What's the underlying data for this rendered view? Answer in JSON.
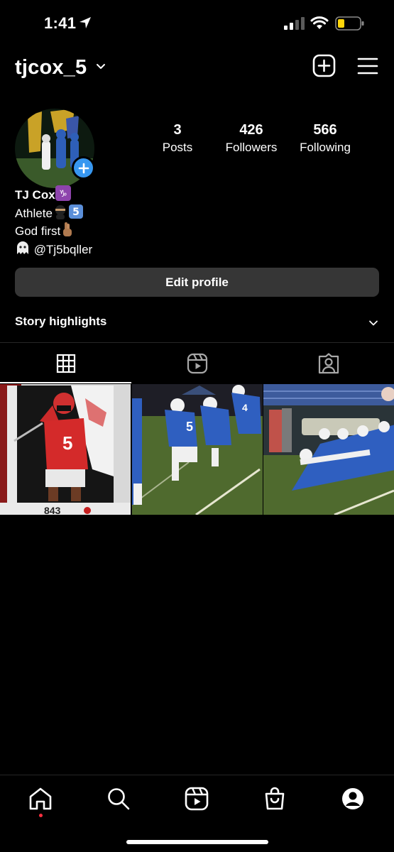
{
  "status_bar": {
    "time": "1:41",
    "icons": [
      "location-arrow-icon",
      "cellular-signal-icon",
      "wifi-icon",
      "battery-icon"
    ],
    "battery_color": "#ffd60a"
  },
  "header": {
    "username": "tjcox_5",
    "icons": [
      "chevron-down-icon",
      "add-post-icon",
      "hamburger-menu-icon"
    ]
  },
  "profile": {
    "stats": [
      {
        "value": "3",
        "label": "Posts"
      },
      {
        "value": "426",
        "label": "Followers"
      },
      {
        "value": "566",
        "label": "Following"
      }
    ],
    "name": "TJ Cox",
    "bio_lines": [
      "Athlete",
      "God first",
      "@Tj5bqller"
    ],
    "accent_color": "#3797f0"
  },
  "actions": {
    "edit_profile": "Edit profile"
  },
  "highlights": {
    "title": "Story highlights"
  },
  "tabs": [
    {
      "icon": "grid-icon",
      "active": true
    },
    {
      "icon": "reels-icon",
      "active": false
    },
    {
      "icon": "tagged-icon",
      "active": false
    }
  ],
  "posts": [
    {
      "description_icon": "football-player-red-jersey-photo"
    },
    {
      "description_icon": "football-game-blue-team-photo"
    },
    {
      "description_icon": "football-lineup-blue-team-photo"
    }
  ],
  "bottom_nav": {
    "items": [
      "home-icon",
      "search-icon",
      "reels-icon",
      "shop-icon",
      "profile-icon"
    ],
    "notification_color": "#ff3040"
  }
}
